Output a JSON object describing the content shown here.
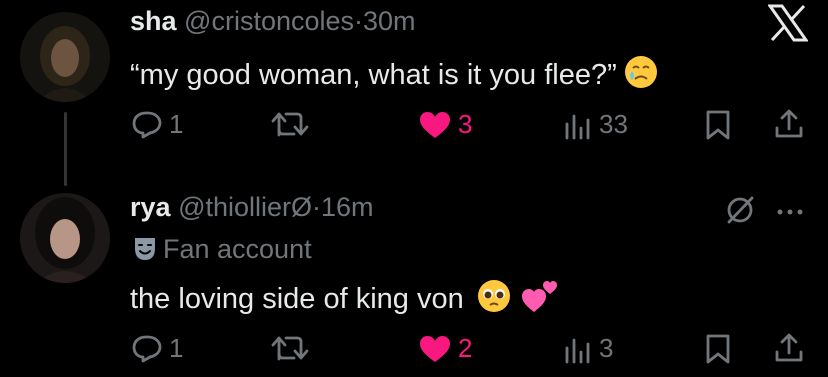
{
  "tweets": [
    {
      "author": {
        "name": "sha",
        "handle": "@cristoncoles",
        "time": "30m"
      },
      "text": "“my good woman, what is it you flee?”",
      "emoji": [
        "face-holding-back-tears-icon"
      ],
      "actions": {
        "replies": "1",
        "retweets": "",
        "likes": "3",
        "views": "33"
      },
      "liked": true
    },
    {
      "author": {
        "name": "rya",
        "handle": "@thiollierØ",
        "time": "16m"
      },
      "label": "Fan account",
      "text": "the loving side of king von",
      "emoji": [
        "pleading-face-icon",
        "two-hearts-icon"
      ],
      "actions": {
        "replies": "1",
        "retweets": "",
        "likes": "2",
        "views": "3"
      },
      "liked": true
    }
  ],
  "separator": "·",
  "colors": {
    "background": "#000000",
    "text": "#e7e9ea",
    "muted": "#71767b",
    "like": "#f91880",
    "thread": "#333639"
  }
}
